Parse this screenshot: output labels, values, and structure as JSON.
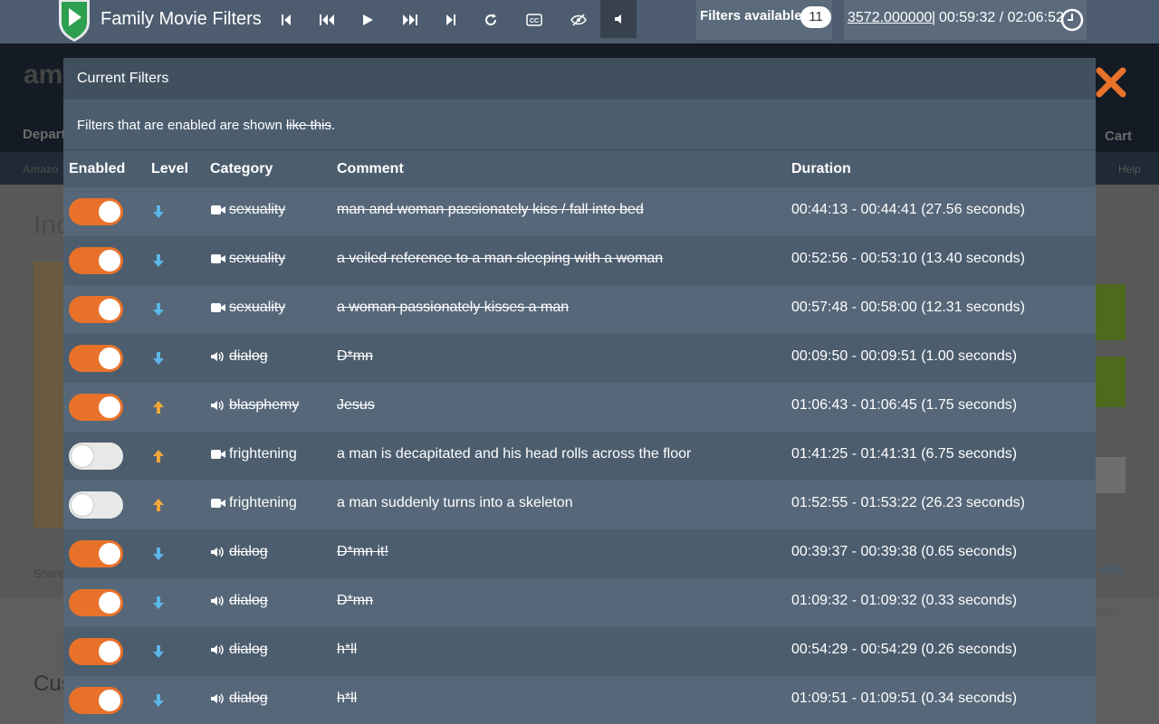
{
  "toolbar": {
    "title": "Family Movie Filters",
    "filters_label": "Filters available:",
    "filters_count": "11",
    "position": "3572.000000",
    "separator": "|",
    "time": "00:59:32 / 02:06:52",
    "controls": [
      "skip-start-icon",
      "rewind-icon",
      "play-icon",
      "fast-forward-icon",
      "skip-end-icon",
      "refresh-icon",
      "cc-icon",
      "hide-icon",
      "volume-icon"
    ],
    "accent": "#4d5d6f"
  },
  "modal": {
    "header": "Current Filters",
    "note_prefix": "Filters that are enabled are shown ",
    "note_example": "like this",
    "note_suffix": ".",
    "columns": {
      "enabled": "Enabled",
      "level": "Level",
      "category": "Category",
      "comment": "Comment",
      "duration": "Duration"
    },
    "colors": {
      "toggle_on": "#e8722a",
      "level_down": "#5bb6e8",
      "level_up": "#f0a63a"
    },
    "rows": [
      {
        "enabled": true,
        "level": "down",
        "icon": "video-camera-icon",
        "category": "sexuality",
        "comment": "man and woman passionately kiss / fall into bed",
        "duration": "00:44:13 - 00:44:41 (27.56 seconds)"
      },
      {
        "enabled": true,
        "level": "down",
        "icon": "video-camera-icon",
        "category": "sexuality",
        "comment": "a veiled reference to a man sleeping with a woman",
        "duration": "00:52:56 - 00:53:10 (13.40 seconds)"
      },
      {
        "enabled": true,
        "level": "down",
        "icon": "video-camera-icon",
        "category": "sexuality",
        "comment": "a woman passionately kisses a man",
        "duration": "00:57:48 - 00:58:00 (12.31 seconds)"
      },
      {
        "enabled": true,
        "level": "down",
        "icon": "speaker-icon",
        "category": "dialog",
        "comment": "D*mn",
        "duration": "00:09:50 - 00:09:51 (1.00 seconds)"
      },
      {
        "enabled": true,
        "level": "up",
        "icon": "speaker-icon",
        "category": "blasphemy",
        "comment": "Jesus",
        "duration": "01:06:43 - 01:06:45 (1.75 seconds)"
      },
      {
        "enabled": false,
        "level": "up",
        "icon": "video-camera-icon",
        "category": "frightening",
        "comment": "a man is decapitated and his head rolls across the floor",
        "duration": "01:41:25 - 01:41:31 (6.75 seconds)"
      },
      {
        "enabled": false,
        "level": "up",
        "icon": "video-camera-icon",
        "category": "frightening",
        "comment": "a man suddenly turns into a skeleton",
        "duration": "01:52:55 - 01:53:22 (26.23 seconds)"
      },
      {
        "enabled": true,
        "level": "down",
        "icon": "speaker-icon",
        "category": "dialog",
        "comment": "D*mn it!",
        "duration": "00:39:37 - 00:39:38 (0.65 seconds)"
      },
      {
        "enabled": true,
        "level": "down",
        "icon": "speaker-icon",
        "category": "dialog",
        "comment": "D*mn",
        "duration": "01:09:32 - 01:09:32 (0.33 seconds)"
      },
      {
        "enabled": true,
        "level": "down",
        "icon": "speaker-icon",
        "category": "dialog",
        "comment": "h*ll",
        "duration": "00:54:29 - 00:54:29 (0.26 seconds)"
      },
      {
        "enabled": true,
        "level": "down",
        "icon": "speaker-icon",
        "category": "dialog",
        "comment": "h*ll",
        "duration": "01:09:51 - 01:09:51 (0.34 seconds)"
      }
    ]
  },
  "background": {
    "logo": "ama",
    "departments": "Depart",
    "amazon_link": "Amazo",
    "cart": "Cart",
    "help": "Help",
    "title_fragment": "Inc",
    "share": "Share",
    "customers": "Cus",
    "help_link": "Help",
    "apply": "apply."
  }
}
